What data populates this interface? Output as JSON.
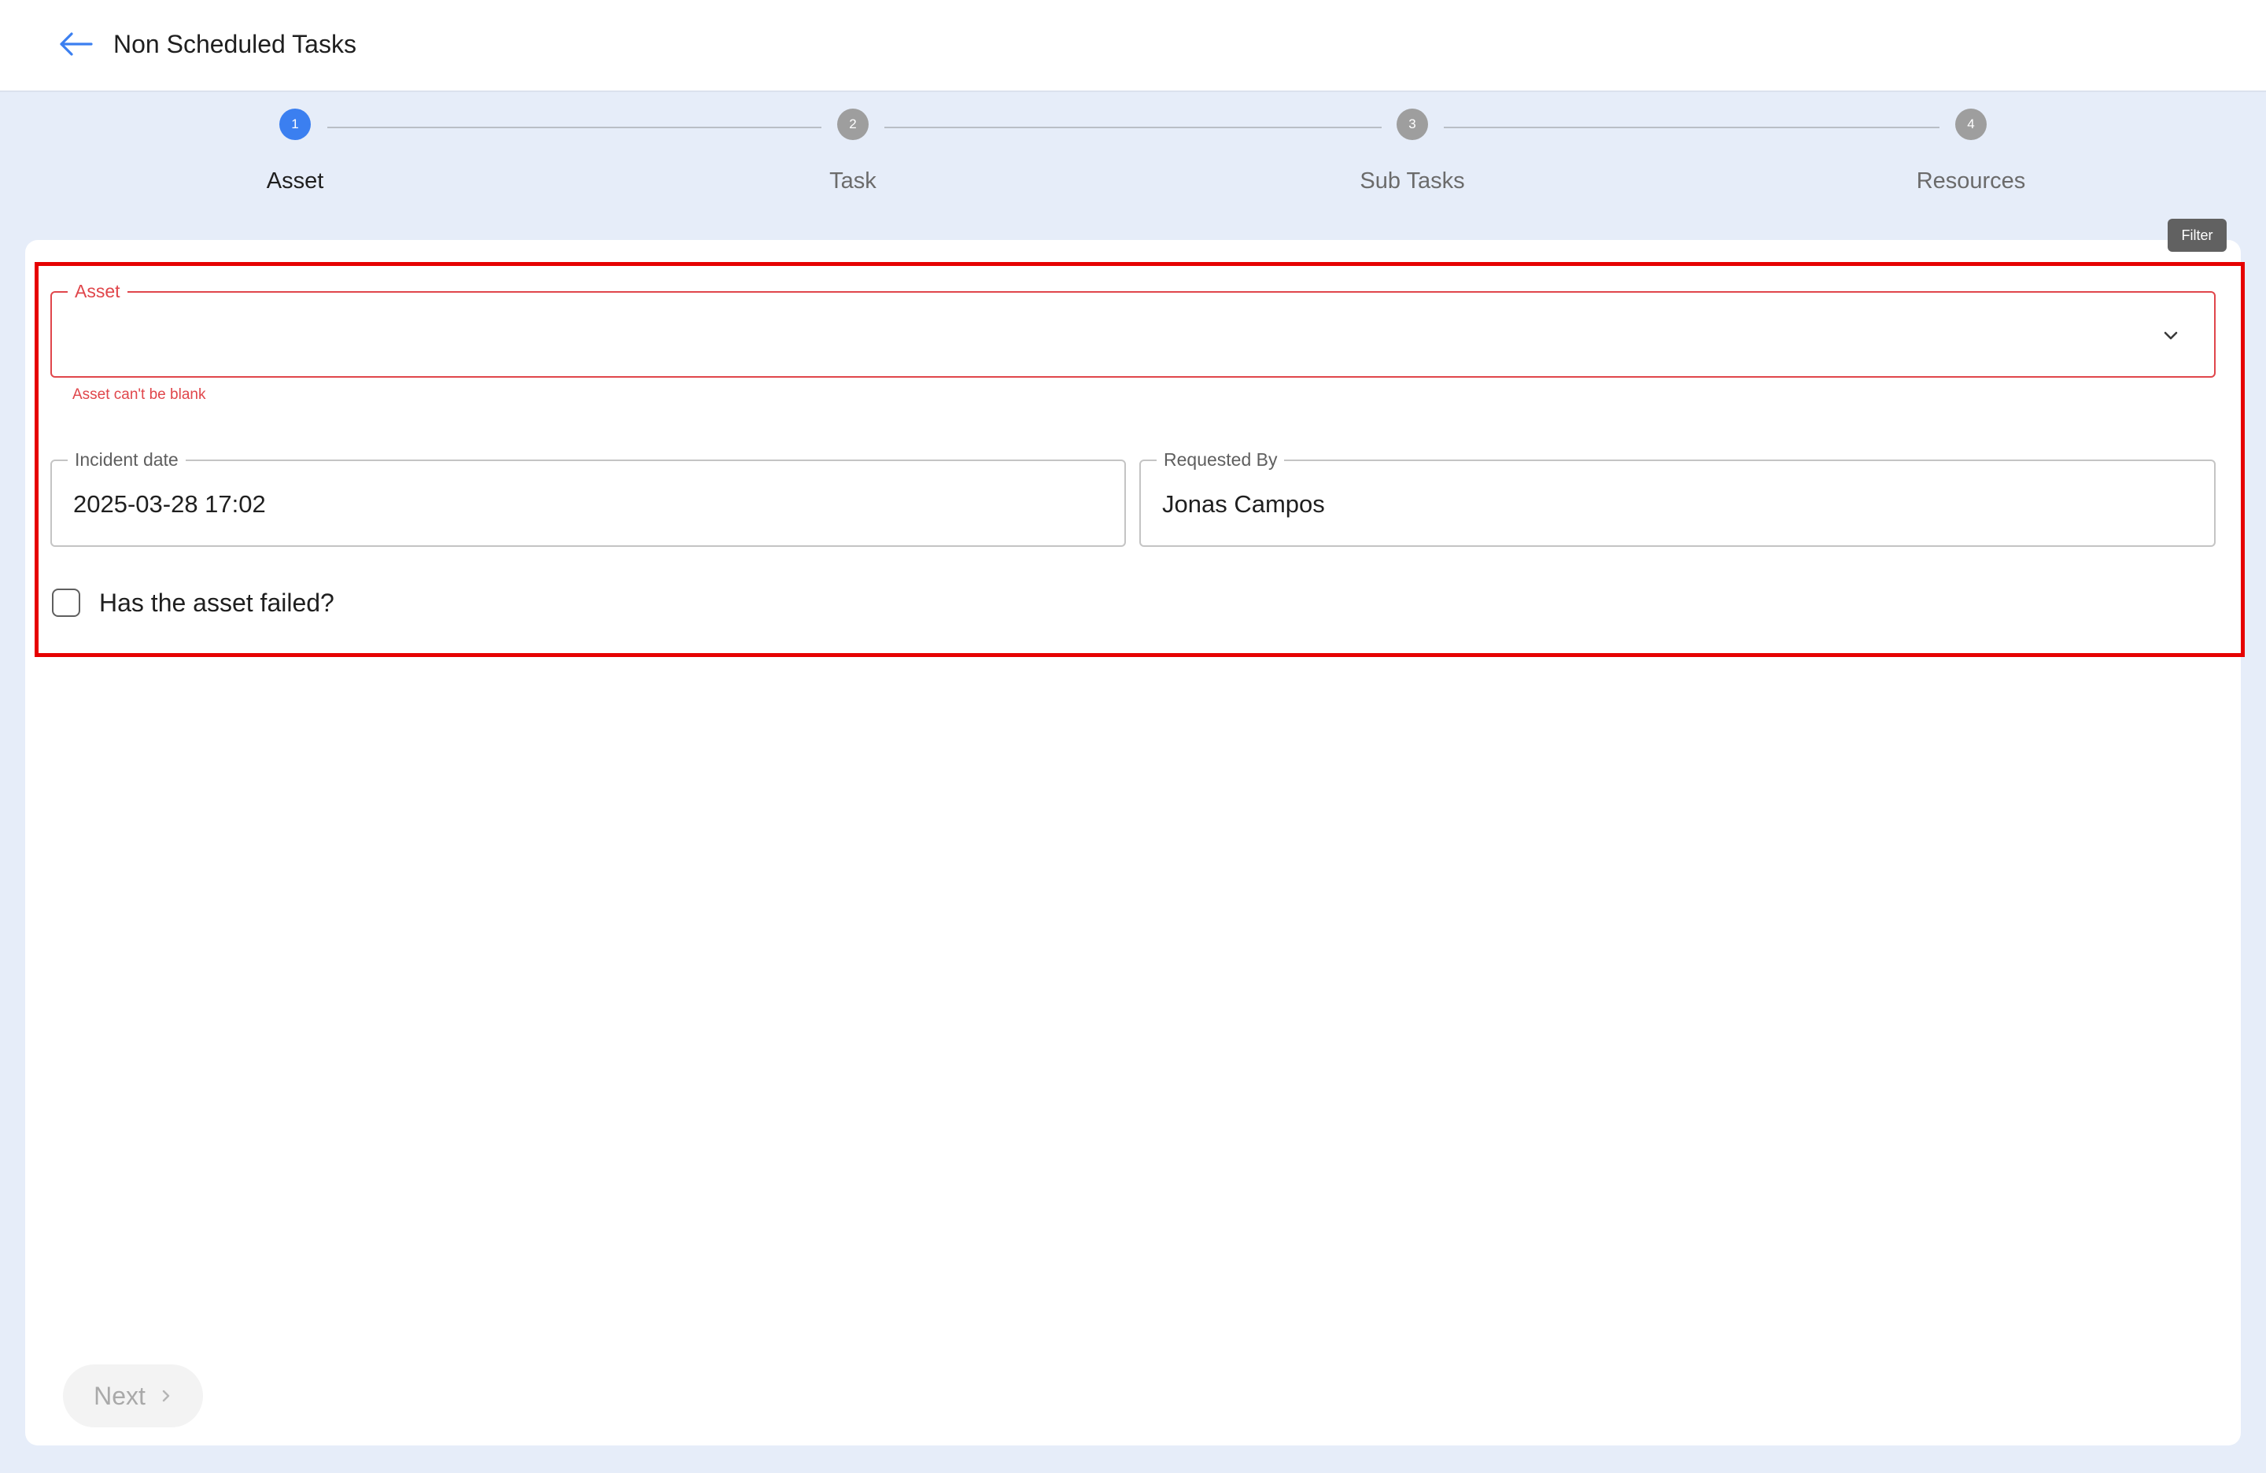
{
  "header": {
    "title": "Non Scheduled Tasks",
    "back_icon": "arrow-left-icon"
  },
  "stepper": {
    "steps": [
      {
        "number": "1",
        "label": "Asset",
        "active": true
      },
      {
        "number": "2",
        "label": "Task",
        "active": false
      },
      {
        "number": "3",
        "label": "Sub Tasks",
        "active": false
      },
      {
        "number": "4",
        "label": "Resources",
        "active": false
      }
    ]
  },
  "filter_chip": {
    "label": "Filter"
  },
  "form": {
    "asset": {
      "label": "Asset",
      "value": "",
      "error": "Asset can't be blank"
    },
    "incident_date": {
      "label": "Incident date",
      "value": "2025-03-28 17:02"
    },
    "requested_by": {
      "label": "Requested By",
      "value": "Jonas Campos"
    },
    "asset_failed": {
      "label": "Has the asset failed?",
      "checked": false
    }
  },
  "footer": {
    "next_label": "Next"
  },
  "colors": {
    "accent": "#3b7ff0",
    "error": "#e0464b",
    "highlight": "#e60000",
    "background": "#e6edf9"
  }
}
